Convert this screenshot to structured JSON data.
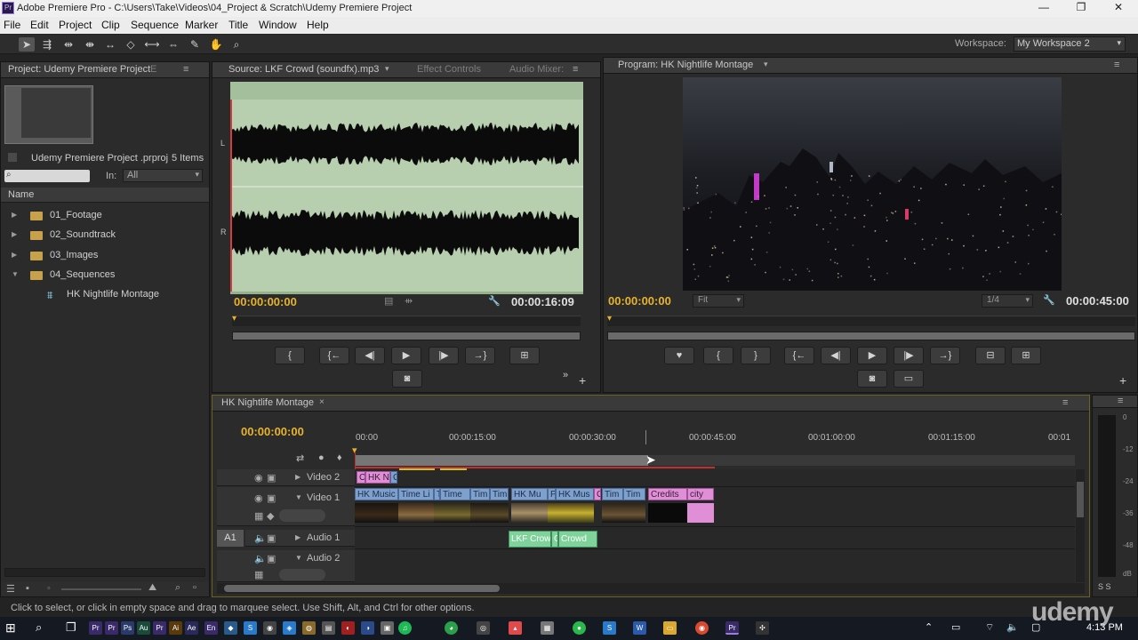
{
  "window": {
    "title": "Adobe Premiere Pro - C:\\Users\\Take\\Videos\\04_Project & Scratch\\Udemy Premiere Project",
    "logo": "Pr"
  },
  "menu": [
    "File",
    "Edit",
    "Project",
    "Clip",
    "Sequence",
    "Marker",
    "Title",
    "Window",
    "Help"
  ],
  "workspace": {
    "label": "Workspace:",
    "value": "My Workspace 2"
  },
  "project": {
    "tab": "Project: Udemy Premiere Project",
    "file": "Udemy Premiere Project .prproj",
    "count": "5 Items",
    "in_label": "In:",
    "in_value": "All",
    "column": "Name",
    "items": [
      "01_Footage",
      "02_Soundtrack",
      "03_Images",
      "04_Sequences"
    ],
    "sequence": "HK Nightlife Montage"
  },
  "source": {
    "tab": "Source: LKF Crowd (soundfx).mp3",
    "tab2": "Effect Controls",
    "tab3": "Audio Mixer:",
    "tc_in": "00:00:00:00",
    "tc_dur": "00:00:16:09",
    "ch_l": "L",
    "ch_r": "R"
  },
  "program": {
    "tab": "Program: HK Nightlife Montage",
    "tc_in": "00:00:00:00",
    "tc_dur": "00:00:45:00",
    "fit": "Fit",
    "res": "1/4"
  },
  "timeline": {
    "tab": "HK Nightlife Montage",
    "tc": "00:00:00:00",
    "ruler": [
      "00:00",
      "00:00:15:00",
      "00:00:30:00",
      "00:00:45:00",
      "00:01:00:00",
      "00:01:15:00",
      "00:01"
    ],
    "tracks": {
      "v2": "Video 2",
      "v1": "Video 1",
      "a1": "Audio 1",
      "a2": "Audio 2",
      "a1_tag": "A1"
    },
    "clips_v2": [
      "C",
      "HK N",
      "C"
    ],
    "clips_v1": [
      "HK Music",
      "Time Li",
      "T",
      "Time",
      "Tim",
      "Tim",
      "HK Mu",
      "P",
      "HK Mus",
      "C",
      "Tim",
      "Tim",
      "Credits",
      "city"
    ],
    "clips_a1": [
      "LKF Crow",
      "C",
      "Crowd"
    ]
  },
  "meter": [
    "0",
    "-12",
    "-24",
    "-36",
    "-48",
    "dB"
  ],
  "meter_solo": "S  S",
  "status": "Click to select, or click in empty space and drag to marquee select. Use Shift, Alt, and Ctrl for other options.",
  "taskbar": {
    "time": "4:13 PM"
  },
  "watermark": "udemy"
}
